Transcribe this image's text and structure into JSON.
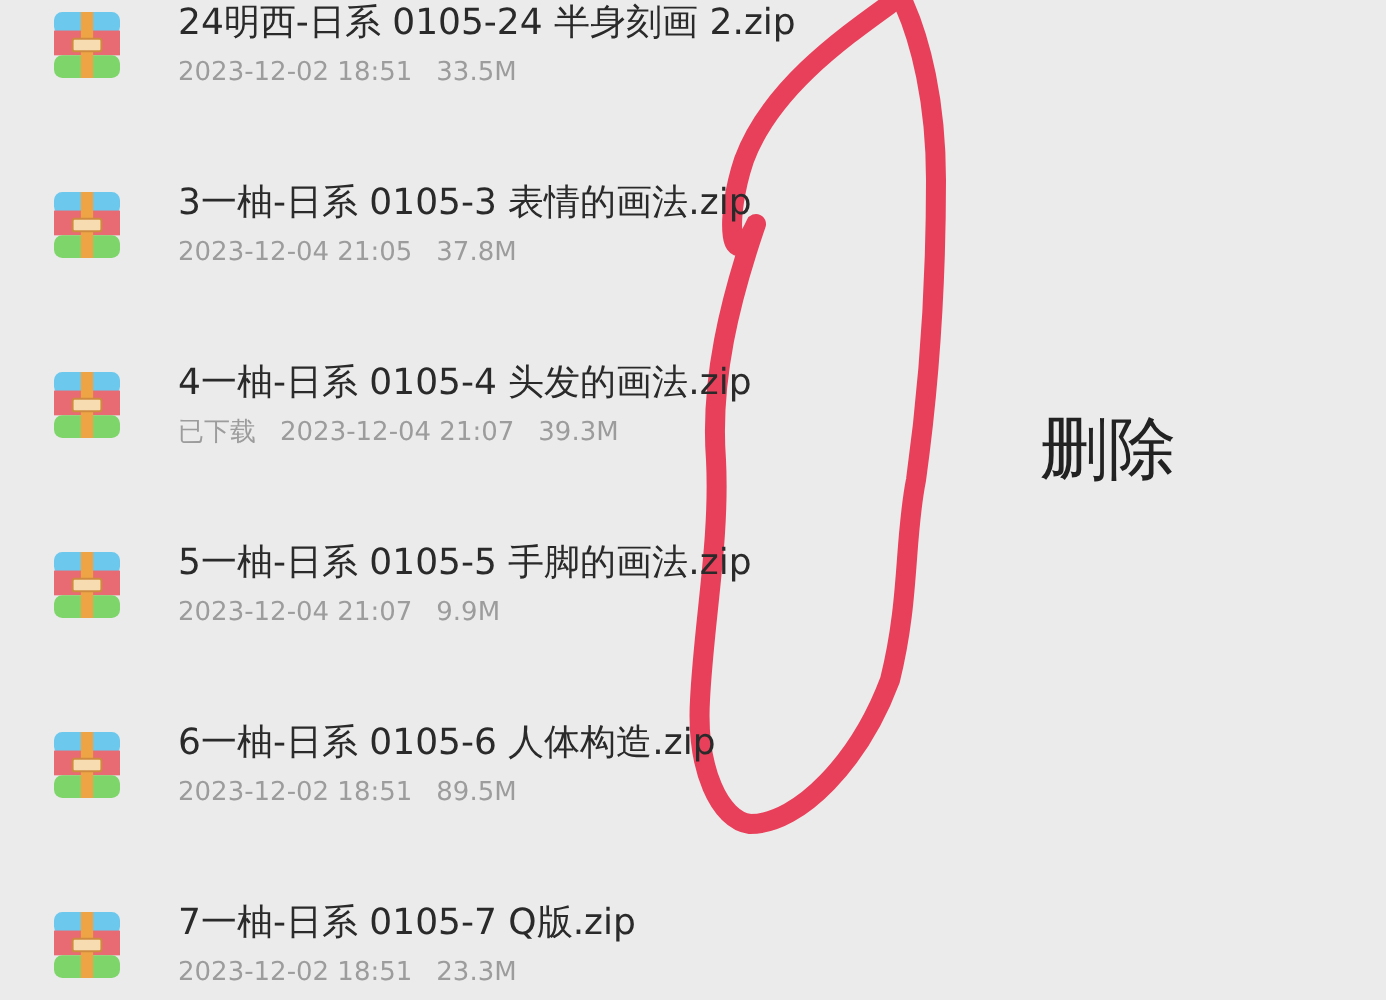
{
  "files": [
    {
      "name": "24明西-日系 0105-24 半身刻画 2.zip",
      "date": "2023-12-02 18:51",
      "size": "33.5M"
    },
    {
      "name": "3一柚-日系 0105-3 表情的画法.zip",
      "date": "2023-12-04 21:05",
      "size": "37.8M"
    },
    {
      "name": "4一柚-日系 0105-4 头发的画法.zip",
      "status": "已下载",
      "date": "2023-12-04 21:07",
      "size": "39.3M"
    },
    {
      "name": "5一柚-日系 0105-5 手脚的画法.zip",
      "date": "2023-12-04 21:07",
      "size": "9.9M"
    },
    {
      "name": "6一柚-日系 0105-6 人体构造.zip",
      "date": "2023-12-02 18:51",
      "size": "89.5M"
    },
    {
      "name": "7一柚-日系 0105-7 Q版.zip",
      "date": "2023-12-02 18:51",
      "size": "23.3M"
    }
  ],
  "annotation": {
    "label": "删除"
  }
}
